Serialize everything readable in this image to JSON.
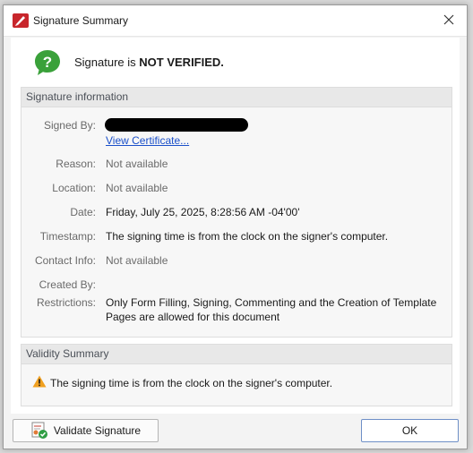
{
  "window": {
    "title": "Signature Summary",
    "app_icon": "pdf-editor-icon",
    "close_icon": "close-icon"
  },
  "status": {
    "prefix": "Signature is",
    "state": "NOT VERIFIED.",
    "icon": "question-icon",
    "icon_color": "#3aa13a"
  },
  "signature_info": {
    "header": "Signature information",
    "signed_by_label": "Signed By:",
    "view_certificate": "View Certificate...",
    "reason_label": "Reason:",
    "reason_value": "Not available",
    "location_label": "Location:",
    "location_value": "Not available",
    "date_label": "Date:",
    "date_value": "Friday, July 25, 2025, 8:28:56 AM -04'00'",
    "timestamp_label": "Timestamp:",
    "timestamp_value": "The signing time is from the clock on the signer's computer.",
    "contact_label": "Contact Info:",
    "contact_value": "Not available",
    "created_label": "Created By:",
    "restrictions_label": "Restrictions:",
    "restrictions_line1": "Only Form Filling, Signing, Commenting and the Creation of Template",
    "restrictions_line2": "Pages are allowed for this document"
  },
  "validity": {
    "header": "Validity Summary",
    "message": "The signing time is from the clock on the signer's computer.",
    "icon": "warning-icon"
  },
  "buttons": {
    "validate": "Validate Signature",
    "validate_icon": "certificate-check-icon",
    "ok": "OK"
  },
  "colors": {
    "link": "#1a4fc9",
    "warning": "#f0a020",
    "accent_border": "#6e8fc7"
  }
}
